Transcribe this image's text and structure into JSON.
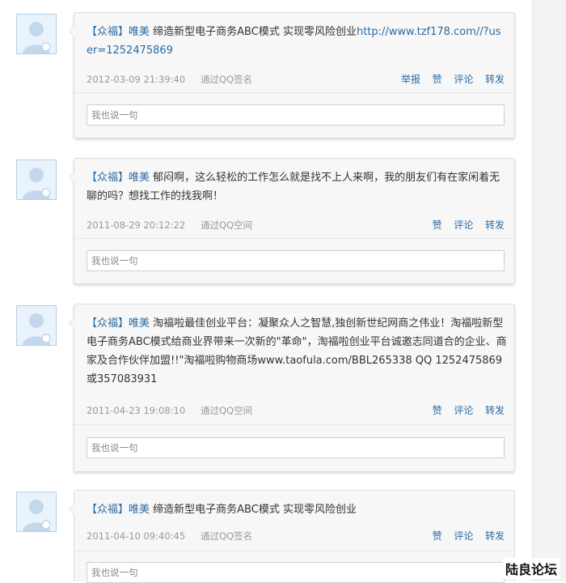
{
  "posts": [
    {
      "author": "【众福】唯美",
      "content": "缔造新型电子商务ABC模式 实现零风险创业",
      "link": "http://www.tzf178.com//?user=1252475869",
      "date": "2012-03-09 21:39:40",
      "via": "通过QQ签名",
      "actions": {
        "report": "举报",
        "like": "赞",
        "comment": "评论",
        "forward": "转发"
      },
      "reply_placeholder": "我也说一句"
    },
    {
      "author": "【众福】唯美",
      "content": "郁闷啊，这么轻松的工作怎么就是找不上人来啊，我的朋友们有在家闲着无聊的吗？想找工作的找我啊！",
      "date": "2011-08-29 20:12:22",
      "via": "通过QQ空间",
      "actions": {
        "like": "赞",
        "comment": "评论",
        "forward": "转发"
      },
      "reply_placeholder": "我也说一句"
    },
    {
      "author": "【众福】唯美",
      "content": "淘福啦最佳创业平台：凝聚众人之智慧,独创新世纪网商之伟业！淘福啦新型电子商务ABC模式给商业界带来一次新的\"革命\"，淘福啦创业平台诚邀志同道合的企业、商家及合作伙伴加盟!!\"淘福啦购物商场www.taofula.com/BBL265338 QQ 1252475869或357083931",
      "date": "2011-04-23 19:08:10",
      "via": "通过QQ空间",
      "actions": {
        "like": "赞",
        "comment": "评论",
        "forward": "转发"
      },
      "reply_placeholder": "我也说一句"
    },
    {
      "author": "【众福】唯美",
      "content": "缔造新型电子商务ABC模式 实现零风险创业",
      "date": "2011-04-10 09:40:45",
      "via": "通过QQ签名",
      "actions": {
        "like": "赞",
        "comment": "评论",
        "forward": "转发"
      },
      "reply_placeholder": "我也说一句"
    }
  ],
  "watermark": "陆良论坛",
  "colors": {
    "link": "#2b6aa3",
    "meta": "#999999",
    "card_bg": "#f7f7f7"
  },
  "icons": {
    "avatar": "default-avatar-icon"
  }
}
